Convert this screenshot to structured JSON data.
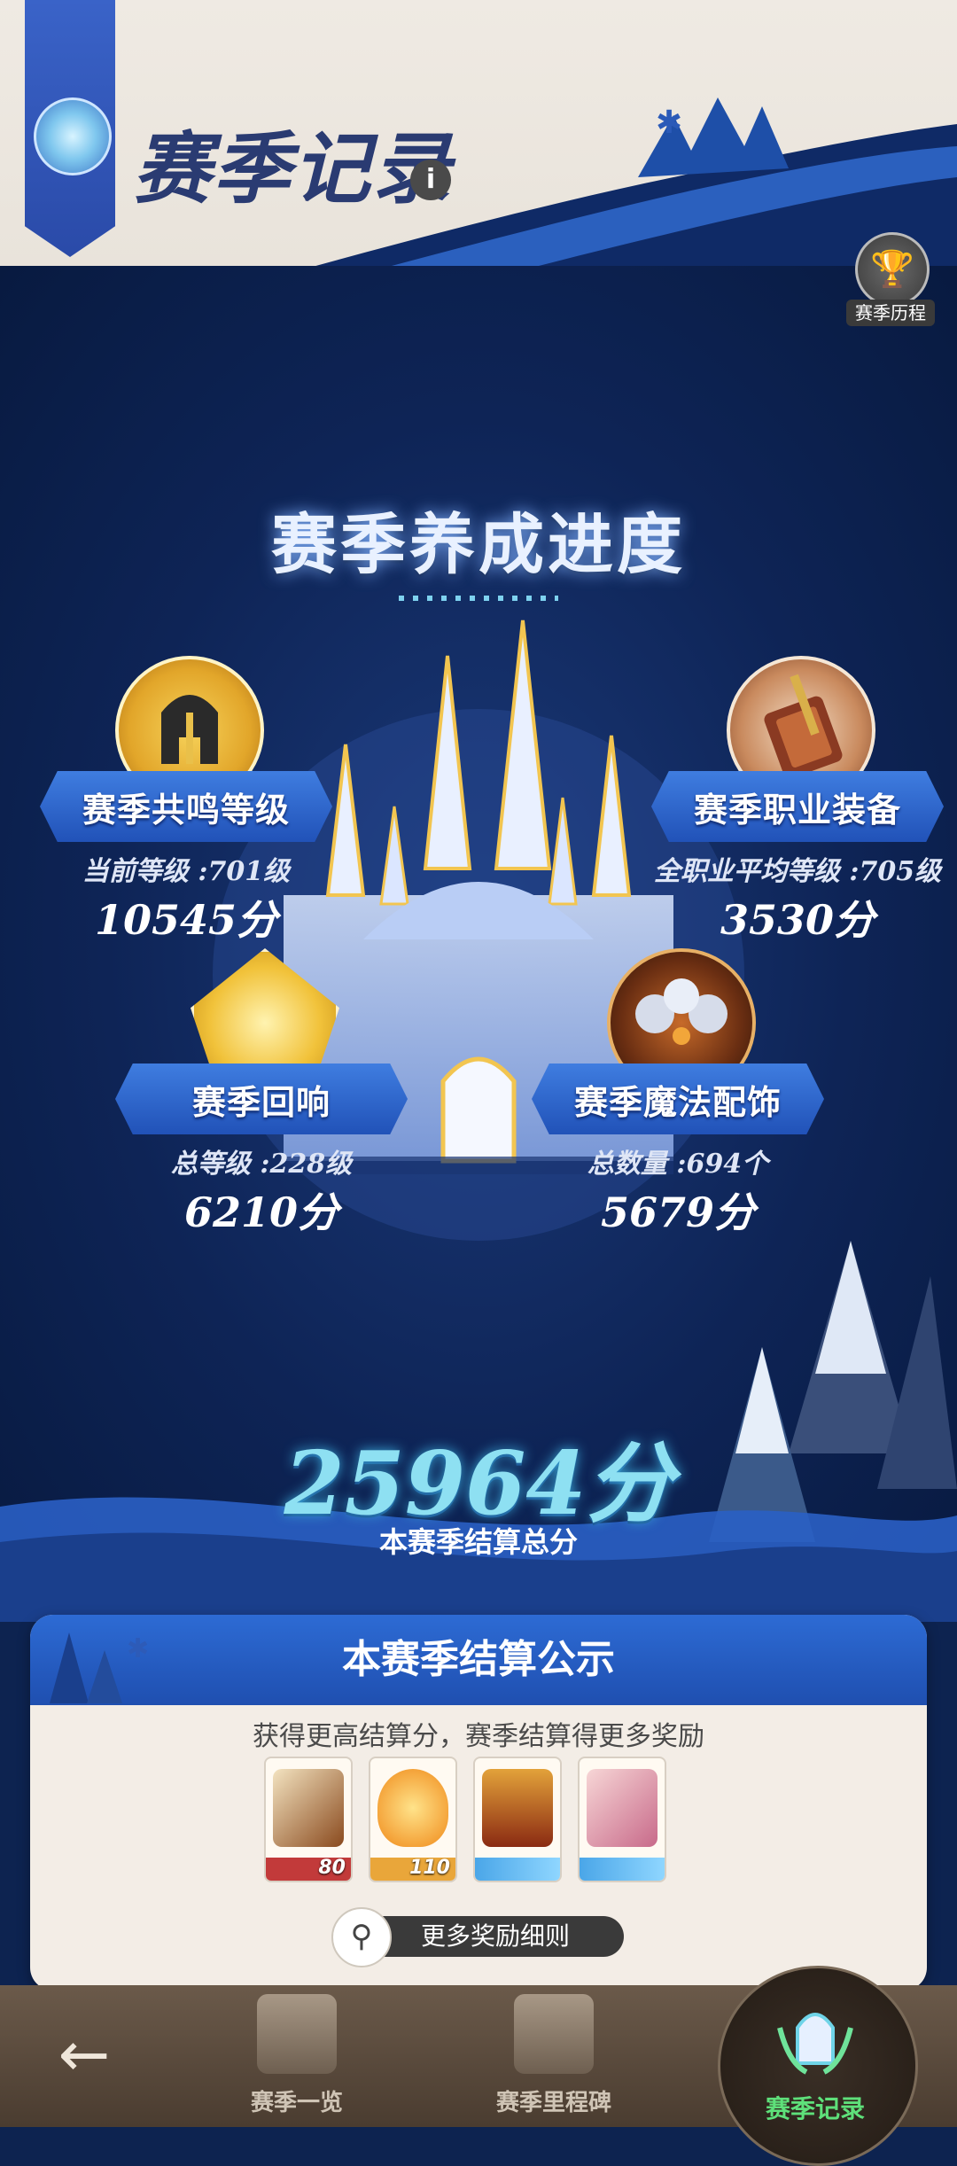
{
  "header": {
    "title": "赛季记录",
    "info_icon": "i",
    "history_label": "赛季历程"
  },
  "progress": {
    "title": "赛季养成进度",
    "cards": [
      {
        "label": "赛季共鸣等级",
        "detail": "当前等级 :701级",
        "score": "10545分"
      },
      {
        "label": "赛季职业装备",
        "detail": "全职业平均等级 :705级",
        "score": "3530分"
      },
      {
        "label": "赛季回响",
        "detail": "总等级 :228级",
        "score": "6210分"
      },
      {
        "label": "赛季魔法配饰",
        "detail": "总数量 :694个",
        "score": "5679分"
      }
    ],
    "total_score": "25964分",
    "total_label": "本赛季结算总分"
  },
  "settlement": {
    "title": "本赛季结算公示",
    "description": "获得更高结算分，赛季结算得更多奖励",
    "rewards": [
      {
        "icon": "envelope-icon",
        "qty": "80"
      },
      {
        "icon": "crystal-icon",
        "qty": "110"
      },
      {
        "icon": "chest-icon",
        "qty": ""
      },
      {
        "icon": "ticket-icon",
        "qty": ""
      }
    ],
    "more_label": "更多奖励细则"
  },
  "nav": {
    "back_icon": "←",
    "overview": "赛季一览",
    "milestone": "赛季里程碑",
    "record": "赛季记录"
  },
  "colors": {
    "accent_blue": "#2d6bd4",
    "total_score": "#8ee0f2",
    "nav_active": "#5ee07a"
  }
}
